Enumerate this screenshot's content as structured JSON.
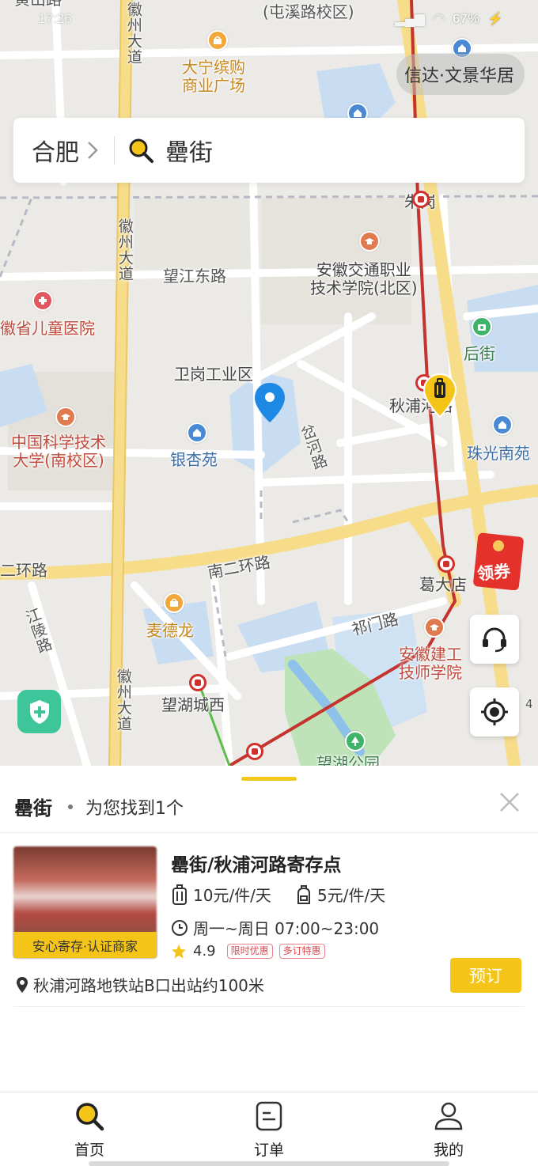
{
  "status_bar": {
    "time": "17:26",
    "battery": "67%"
  },
  "map": {
    "labels": {
      "tunxi_campus": "(屯溪路校区)",
      "huangshan": "黄山路",
      "huizhou_top": "徽州大道",
      "huizhou_mid": "徽州大道",
      "huizhou_bot": "徽州大道",
      "daning": "大宁缤购\n商业广场",
      "xinda": "信达·文景华居",
      "zhugang": "朱岗",
      "wangjiang": "望江东路",
      "anhui_jiaotong": "安徽交通职业\n技术学院(北区)",
      "children_hospital": "徽省儿童医院",
      "houjie": "后街",
      "weigang": "卫岗工业区",
      "qiupu": "秋浦河路",
      "ustc": "中国科学技术\n大学(南校区)",
      "yinxingyuan": "银杏苑",
      "chahe": "岔河路",
      "zhuguang": "珠光南苑",
      "ring_left": "二环路",
      "ring_south": "南二环路",
      "gedadian": "葛大店",
      "jiangling": "江陵路",
      "maidelong": "麦德龙",
      "qimen": "祁门路",
      "anhui_jiangong": "安徽建工\n技师学院",
      "wanghu": "望湖城西",
      "park": "望湖公园",
      "side_num": "4"
    },
    "coupon_label": "领券"
  },
  "search": {
    "city": "合肥",
    "keyword": "罍街"
  },
  "results": {
    "keyword": "罍街",
    "count_text": "为您找到1个",
    "items": [
      {
        "name": "罍街/秋浦河路寄存点",
        "badge": "安心寄存·认证商家",
        "luggage_price": "10元/件/天",
        "bag_price": "5元/件/天",
        "hours": "周一~周日 07:00~23:00",
        "rating": "4.9",
        "tags": [
          "限时优惠",
          "多订特惠"
        ],
        "address": "秋浦河路地铁站B口出站约100米",
        "book_label": "预订"
      }
    ]
  },
  "tabs": [
    {
      "label": "首页",
      "icon": "search-icon"
    },
    {
      "label": "订单",
      "icon": "order-icon"
    },
    {
      "label": "我的",
      "icon": "user-icon"
    }
  ],
  "colors": {
    "accent": "#f5c418",
    "metro": "#d0312d",
    "primary_pin": "#1e88e5"
  }
}
